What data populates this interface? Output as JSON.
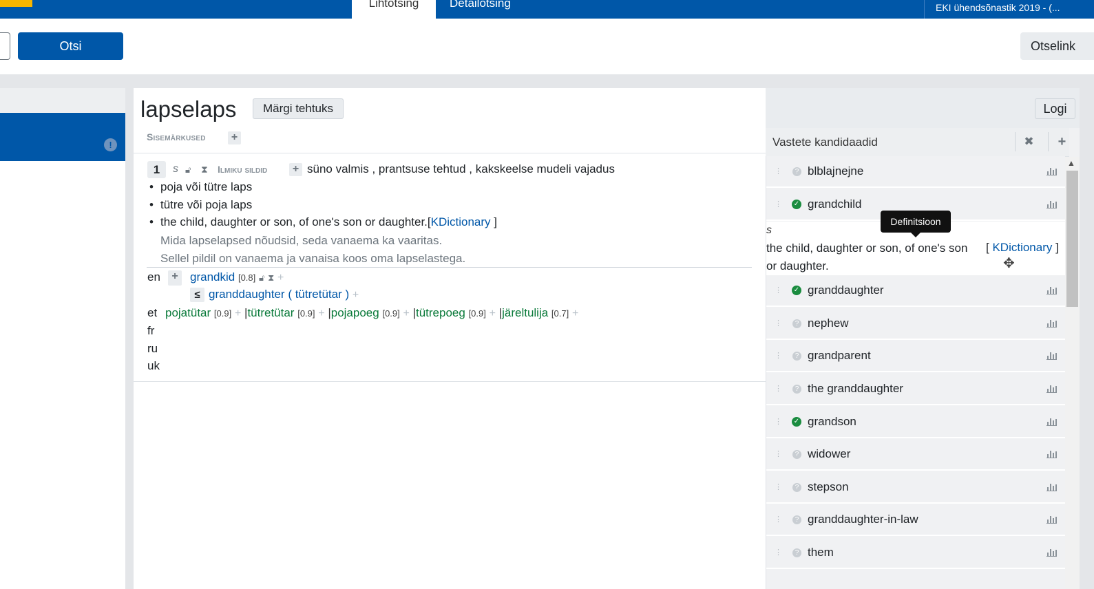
{
  "nav": {
    "tab_simple": "Lihtotsing",
    "tab_detail": "Detailotsing",
    "dictionary": "EKI ühendsõnastik 2019 - (..."
  },
  "search": {
    "button": "Otsi",
    "otselink": "Otselink"
  },
  "entry": {
    "headword": "lapselaps",
    "mark_done": "Märgi tehtuks",
    "log": "Logi",
    "internal_notes": "Sisemärkused",
    "lexeme_num": "1",
    "pos": "s",
    "tags_label": "Ilmiku sildid",
    "tags_values": "süno valmis , prantsuse tehtud , kakskeelse mudeli vajadus",
    "definitions": [
      "poja või tütre laps",
      "tütre või poja laps",
      "the child, daughter or son, of one's son or daughter.["
    ],
    "def3_source": "KDictionary",
    "def3_close": " ]",
    "usages": [
      "Mida lapselapsed nõudsid, seda vanaema ka vaaritas.",
      "Sellel pildil on vanaema ja vanaisa koos oma lapselastega."
    ],
    "langs": {
      "en": "en",
      "et": "et",
      "fr": "fr",
      "ru": "ru",
      "uk": "uk"
    },
    "en_syn": "grandkid",
    "en_syn_weight": "[0.8]",
    "le_symbol": "≤",
    "en_sub_syn": "granddaughter",
    "en_sub_open": " ( ",
    "en_sub_paren": "tütretütar",
    "en_sub_close": " )",
    "et_syns": [
      {
        "word": "pojatütar",
        "weight": "[0.9]"
      },
      {
        "word": "tütretütar",
        "weight": "[0.9]"
      },
      {
        "word": "pojapoeg",
        "weight": "[0.9]"
      },
      {
        "word": "tütrepoeg",
        "weight": "[0.9]"
      },
      {
        "word": "järeltulija",
        "weight": "[0.7]"
      }
    ]
  },
  "candidates": {
    "title": "Vastete kandidaadid",
    "rows": [
      {
        "word": "blblajnejne",
        "status": "unknown"
      },
      {
        "word": "grandchild",
        "status": "ok"
      },
      {
        "word": "granddaughter",
        "status": "ok"
      },
      {
        "word": "nephew",
        "status": "unknown"
      },
      {
        "word": "grandparent",
        "status": "unknown"
      },
      {
        "word": "the granddaughter",
        "status": "unknown"
      },
      {
        "word": "grandson",
        "status": "ok"
      },
      {
        "word": "widower",
        "status": "unknown"
      },
      {
        "word": "stepson",
        "status": "unknown"
      },
      {
        "word": "granddaughter-in-law",
        "status": "unknown"
      },
      {
        "word": "them",
        "status": "unknown"
      }
    ],
    "expanded": {
      "pos": "s",
      "definition": "the child, daughter or son, of one's son or daughter.",
      "source_open": "[ ",
      "source": "KDictionary",
      "source_close": " ]"
    },
    "tooltip": "Definitsioon"
  },
  "colors": {
    "primary": "#0057a8",
    "accent": "#f7b500",
    "success": "#1a8c3f",
    "synonym": "#0a7a3a"
  }
}
